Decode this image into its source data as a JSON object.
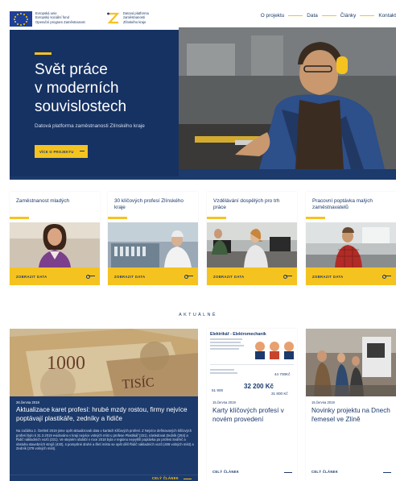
{
  "header": {
    "eu_text": [
      "Evropská unie",
      "Evropský sociální fond",
      "Operační program Zaměstnanost"
    ],
    "logo_text": [
      "Datová platforma",
      "zaměstnanosti",
      "Zlínského kraje"
    ],
    "nav": [
      "O projektu",
      "Data",
      "Články",
      "Kontakt"
    ]
  },
  "hero": {
    "title": [
      "Svět práce",
      "v moderních",
      "souvislostech"
    ],
    "subtitle": "Datová platforma zaměstnanosti Zlínského kraje",
    "button_label": "VÍCE O PROJEKTU"
  },
  "cards": [
    {
      "title": "Zaměstnanost mladých",
      "link_label": "ZOBRAZIT DATA",
      "icon": "person-woman-photo"
    },
    {
      "title": "30 klíčových profesí Zlínského kraje",
      "link_label": "ZOBRAZIT DATA",
      "icon": "lab-worker-photo"
    },
    {
      "title": "Vzdělávání dospělých pro trh práce",
      "link_label": "ZOBRAZIT DATA",
      "icon": "office-photo"
    },
    {
      "title": "Pracovní poptávka malých zaměstnavatelů",
      "link_label": "ZOBRAZIT DATA",
      "icon": "craftsman-photo"
    }
  ],
  "section_title": "AKTUÁLNĚ",
  "news_main": {
    "date": "26.června 2019",
    "title": "Aktualizace karet profesí: hrubé mzdy rostou, firmy nejvíce poptávají plastikáře, zedníky a řidiče",
    "body": "Na začátku 2. čtvrtletí 2019 jsme opět aktualizovali data v kartách klíčových profesí. Z Nejvíce definovaných klíčových profesí bylo k 31.3.2019 evidováno v kraji nejvíce volných míst u profese Plastikář (331), následovat Zedník (284) a Řidič nákladních vozů (331). Ve stejném období v roce 2018 byla v regionu nejvyšší poptávka po profesi Svářeč a obsluha stavebních strojů (430), s pomyslné druhé a třetí místo se opět dělí Řidič nákladních vozů (408 volných míst) a Zedník (378 volných míst).",
    "image_text": [
      "1000",
      "TISÍC"
    ],
    "more_label": "CELÝ ČLÁNEK"
  },
  "news_cards": [
    {
      "date": "15.června 2019",
      "title": "Karty klíčových profesí v novém provedení",
      "more_label": "CELÝ ČLÁNEK",
      "image": {
        "heading": "Elektrikář - Elektromechanik",
        "salary": "32 200 Kč",
        "value1": "51 900",
        "value2": "44 700Kč",
        "value3": "31 800 Kč"
      }
    },
    {
      "date": "15.června 2019",
      "title": "Novinky projektu na Dnech řemesel ve Zlíně",
      "more_label": "CELÝ ČLÁNEK"
    }
  ],
  "colors": {
    "navy": "#1c3a6b",
    "yellow": "#f5c320",
    "text": "#1b3a6b"
  }
}
